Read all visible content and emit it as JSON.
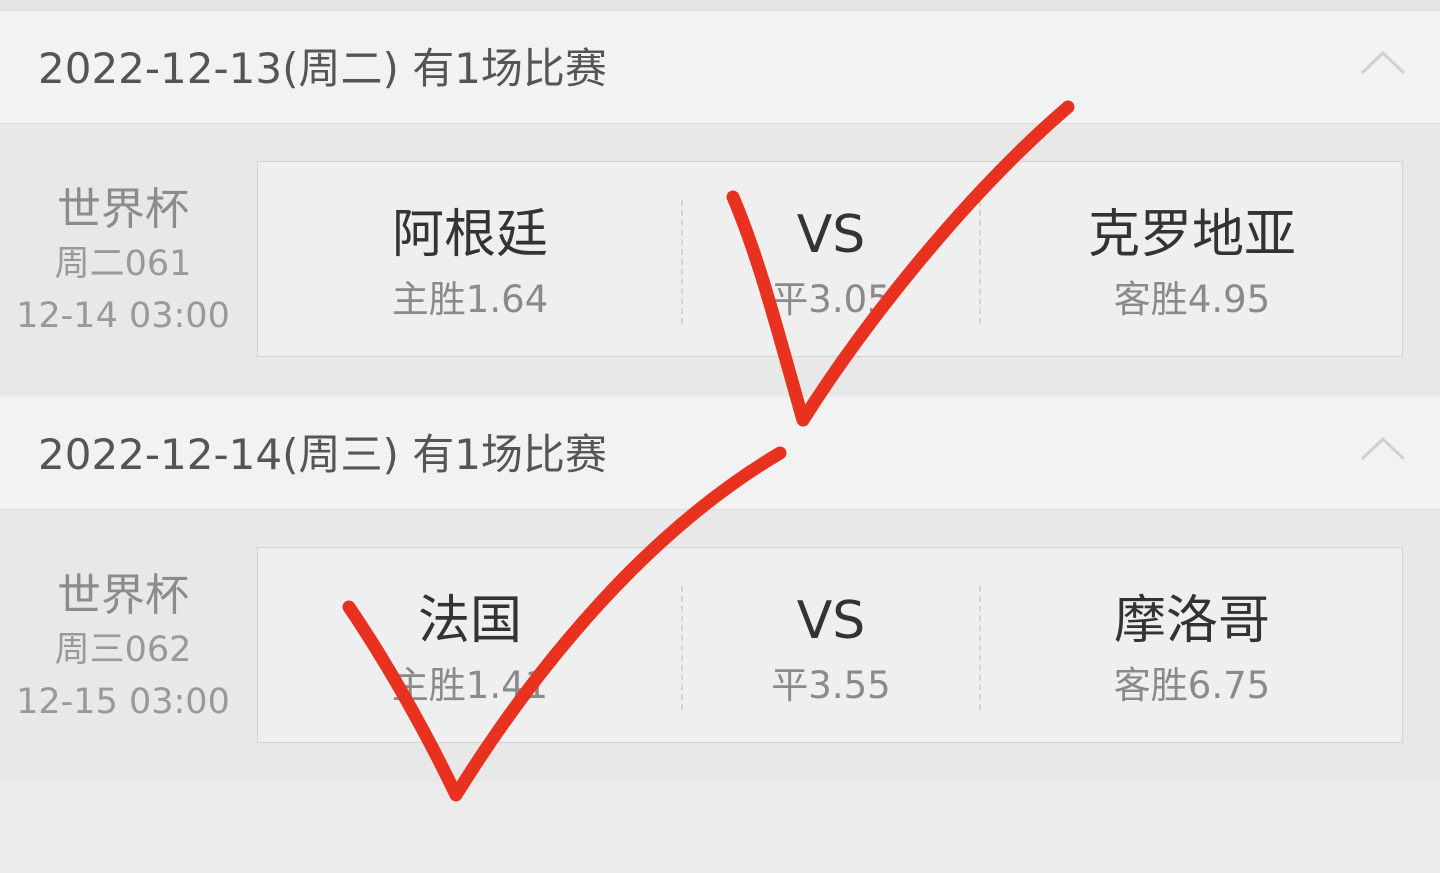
{
  "sections": [
    {
      "date_header": "2022-12-13(周二) 有1场比赛",
      "league": "世界杯",
      "code": "周二061",
      "kickoff": "12-14 03:00",
      "home": {
        "team": "阿根廷",
        "odds": "主胜1.64"
      },
      "draw": {
        "label": "VS",
        "odds": "平3.05"
      },
      "away": {
        "team": "克罗地亚",
        "odds": "客胜4.95"
      }
    },
    {
      "date_header": "2022-12-14(周三) 有1场比赛",
      "league": "世界杯",
      "code": "周三062",
      "kickoff": "12-15 03:00",
      "home": {
        "team": "法国",
        "odds": "主胜1.41"
      },
      "draw": {
        "label": "VS",
        "odds": "平3.55"
      },
      "away": {
        "team": "摩洛哥",
        "odds": "客胜6.75"
      }
    }
  ],
  "icons": {
    "collapse": "chevron-up-icon",
    "annotation": "red-checkmark"
  },
  "colors": {
    "background": "#ebebeb",
    "header_background": "#f2f2f2",
    "card_background": "#efefef",
    "checkmark": "#e8321f"
  }
}
